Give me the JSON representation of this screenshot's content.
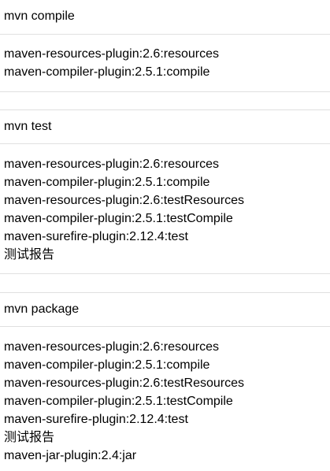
{
  "sections": [
    {
      "title": "mvn compile",
      "lines": [
        "maven-resources-plugin:2.6:resources",
        "maven-compiler-plugin:2.5.1:compile"
      ]
    },
    {
      "title": "mvn test",
      "lines": [
        "maven-resources-plugin:2.6:resources",
        "maven-compiler-plugin:2.5.1:compile",
        "maven-resources-plugin:2.6:testResources",
        "maven-compiler-plugin:2.5.1:testCompile",
        "maven-surefire-plugin:2.12.4:test",
        "测试报告"
      ]
    },
    {
      "title": "mvn package",
      "lines": [
        "maven-resources-plugin:2.6:resources",
        "maven-compiler-plugin:2.5.1:compile",
        "maven-resources-plugin:2.6:testResources",
        "maven-compiler-plugin:2.5.1:testCompile",
        "maven-surefire-plugin:2.12.4:test",
        "测试报告",
        "maven-jar-plugin:2.4:jar"
      ]
    }
  ]
}
